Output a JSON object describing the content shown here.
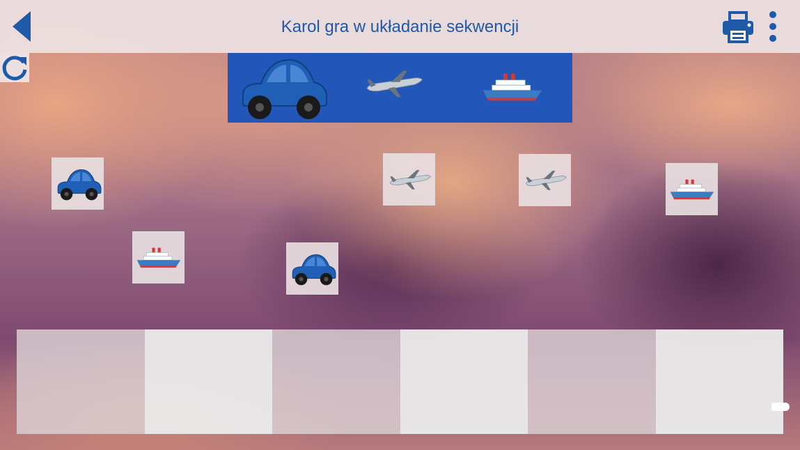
{
  "header": {
    "title": "Karol gra w układanie sekwencji",
    "back_icon": "back-arrow-icon",
    "print_icon": "printer-icon",
    "menu_icon": "more-vertical-icon"
  },
  "toolbar": {
    "refresh_icon": "refresh-icon"
  },
  "sequence_banner": {
    "items": [
      "car-icon",
      "airplane-icon",
      "ship-icon"
    ]
  },
  "tiles": [
    "car",
    "airplane",
    "airplane",
    "ship",
    "ship",
    "car"
  ],
  "drop_slots": {
    "count": 6
  },
  "colors": {
    "accent": "#1e5aa8",
    "banner": "#2256b8",
    "car": "#1f5fb5"
  }
}
